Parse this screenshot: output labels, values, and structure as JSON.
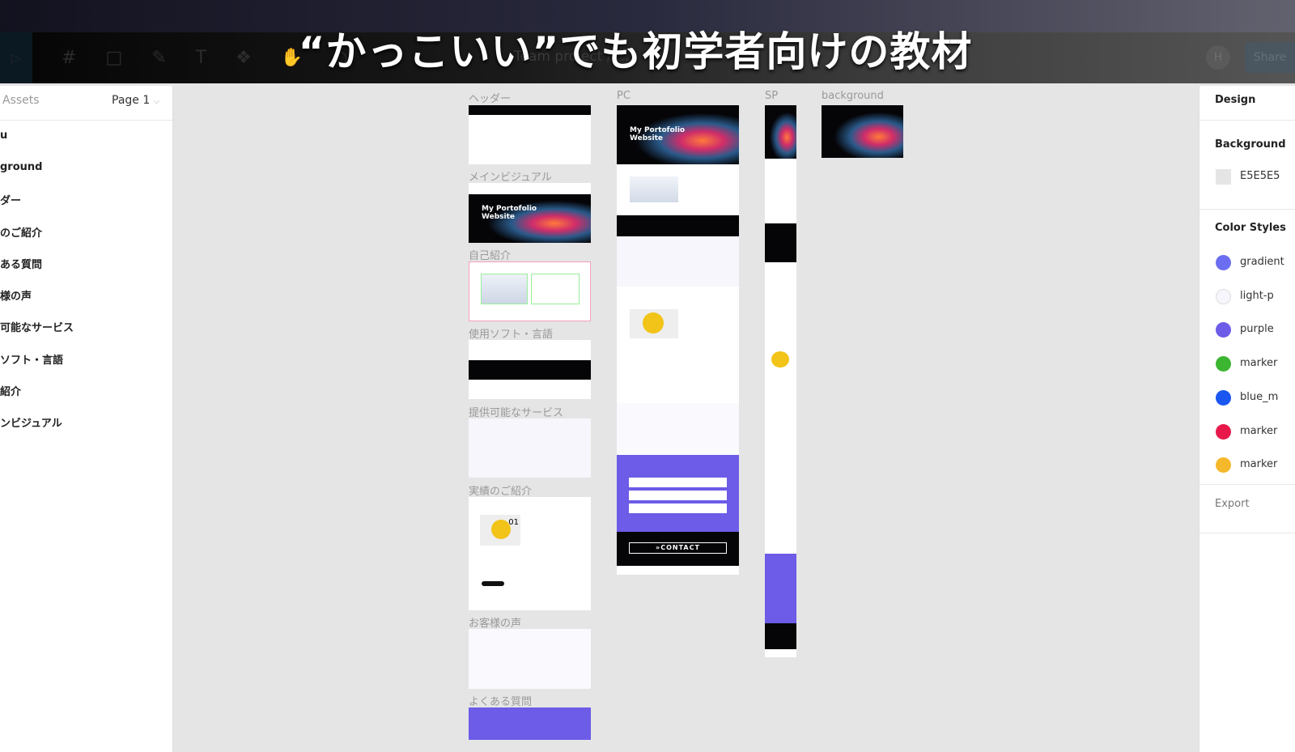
{
  "headline": "“かっこいい”でも初学者向けの教材",
  "toolbar": {
    "project": "Team project / …",
    "avatar": "H",
    "share": "Share"
  },
  "left_panel": {
    "assets": "Assets",
    "page": "Page 1",
    "layers": [
      "u",
      "ground",
      "ダー",
      "のご紹介",
      "ある質問",
      "様の声",
      "可能なサービス",
      "ソフト・言語",
      "紹介",
      "ンビジュアル"
    ]
  },
  "canvas": {
    "labels": {
      "header": "ヘッダー",
      "main_visual": "メインビジュアル",
      "about": "自己紹介",
      "software": "使用ソフト・言語",
      "services": "提供可能なサービス",
      "works": "実績のご紹介",
      "voice": "お客様の声",
      "faq": "よくある質問",
      "pc": "PC",
      "sp": "SP",
      "background": "background"
    },
    "hero_title": "My Portofolio Website",
    "contact": "»CONTACT",
    "works_number": "01"
  },
  "right_panel": {
    "tab": "Design",
    "background_title": "Background",
    "background_value": "E5E5E5",
    "color_styles_title": "Color Styles",
    "styles": [
      {
        "name": "gradient",
        "color": "#6b6ef0"
      },
      {
        "name": "light-p",
        "color": "#f6f6fc"
      },
      {
        "name": "purple",
        "color": "#6c5ce7"
      },
      {
        "name": "marker",
        "color": "#3cb531"
      },
      {
        "name": "blue_m",
        "color": "#1a56f0"
      },
      {
        "name": "marker",
        "color": "#e8194a"
      },
      {
        "name": "marker",
        "color": "#f5b82a"
      }
    ],
    "export": "Export"
  }
}
